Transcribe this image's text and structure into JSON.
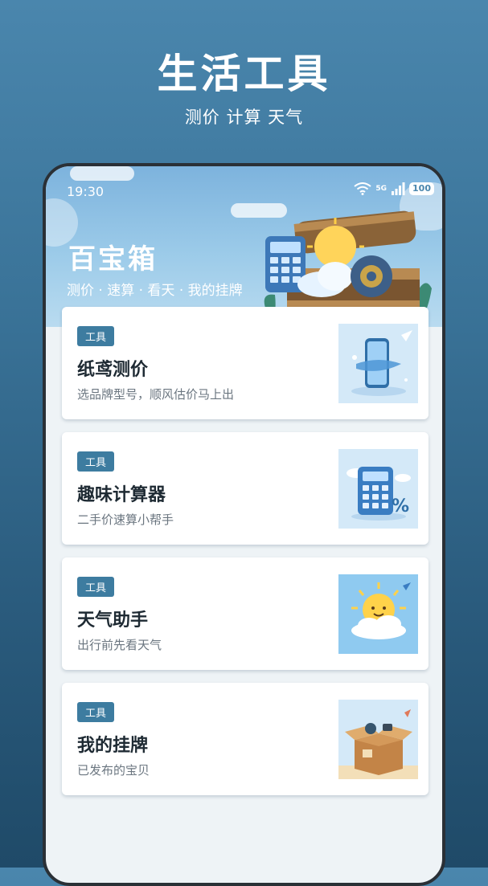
{
  "promo": {
    "title": "生活工具",
    "subtitle": "测价 计算 天气"
  },
  "status": {
    "time": "19:30",
    "network": "5G",
    "battery": "100"
  },
  "hero": {
    "title": "百宝箱",
    "subtitle": "测价 · 速算 · 看天 · 我的挂牌"
  },
  "cards": [
    {
      "tag": "工具",
      "title": "纸鸢测价",
      "desc": "选品牌型号，顺风估价马上出",
      "icon": "phone-price-icon"
    },
    {
      "tag": "工具",
      "title": "趣味计算器",
      "desc": "二手价速算小帮手",
      "icon": "calculator-icon"
    },
    {
      "tag": "工具",
      "title": "天气助手",
      "desc": "出行前先看天气",
      "icon": "sun-cloud-icon"
    },
    {
      "tag": "工具",
      "title": "我的挂牌",
      "desc": "已发布的宝贝",
      "icon": "box-icon"
    }
  ],
  "colors": {
    "accent": "#3d7ca0",
    "background": "#2a5b7d",
    "card": "#ffffff"
  }
}
